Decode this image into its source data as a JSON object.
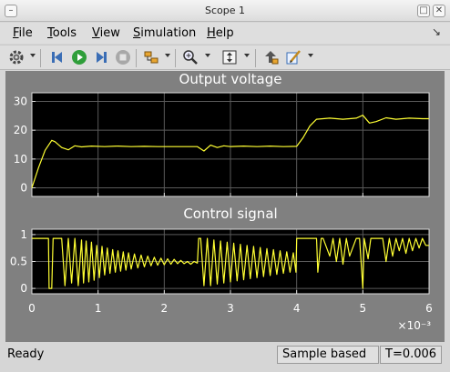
{
  "window": {
    "title": "Scope 1",
    "min_glyph": "–",
    "max_glyph": "□",
    "close_glyph": "✕"
  },
  "menu": {
    "file": {
      "mnemonic": "F",
      "rest": "ile"
    },
    "tools": {
      "mnemonic": "T",
      "rest": "ools"
    },
    "view": {
      "mnemonic": "V",
      "rest": "iew"
    },
    "simulation": {
      "mnemonic": "S",
      "rest": "imulation"
    },
    "help": {
      "mnemonic": "H",
      "rest": "elp"
    },
    "dock_glyph": "↘"
  },
  "toolbar": {
    "icons": [
      "gear-icon",
      "step-back-icon",
      "run-icon",
      "step-forward-icon",
      "stop-icon",
      "signal-selector-icon",
      "zoom-icon",
      "autoscale-icon",
      "highlight-block-icon",
      "style-icon"
    ]
  },
  "colors": {
    "plot_bg": "#000000",
    "trace": "#ffff33",
    "axes": "#dcdcdc",
    "grid": "#5a5a5a",
    "panel": "#808080"
  },
  "status": {
    "ready": "Ready",
    "mode": "Sample based",
    "time": "T=0.006"
  },
  "chart_data": [
    {
      "type": "line",
      "title": "Output voltage",
      "xlabel": "",
      "ylabel": "",
      "xlim": [
        0,
        6
      ],
      "ylim": [
        -3,
        33
      ],
      "x_ticks": [
        0,
        1,
        2,
        3,
        4,
        5,
        6
      ],
      "y_ticks": [
        0,
        10,
        20,
        30
      ],
      "grid": true,
      "series": [
        {
          "x": [
            0,
            0.1,
            0.2,
            0.3,
            0.35,
            0.45,
            0.55,
            0.65,
            0.75,
            0.9,
            1.1,
            1.3,
            1.5,
            1.7,
            1.9,
            2.1,
            2.3,
            2.5,
            2.6,
            2.7,
            2.8,
            2.9,
            3.0,
            3.2,
            3.4,
            3.6,
            3.8,
            4.0,
            4.1,
            4.2,
            4.3,
            4.5,
            4.7,
            4.9,
            5.0,
            5.1,
            5.2,
            5.35,
            5.5,
            5.7,
            5.9,
            6.0
          ],
          "y": [
            0,
            7,
            13,
            16.5,
            16,
            14,
            13.2,
            14.6,
            14.2,
            14.5,
            14.3,
            14.5,
            14.3,
            14.4,
            14.3,
            14.3,
            14.3,
            14.3,
            12.8,
            14.8,
            14.0,
            14.6,
            14.3,
            14.5,
            14.3,
            14.5,
            14.3,
            14.4,
            17.5,
            21.5,
            23.8,
            24.2,
            23.8,
            24.2,
            25.2,
            22.5,
            23.0,
            24.3,
            23.8,
            24.2,
            24.0,
            24.0
          ]
        }
      ]
    },
    {
      "type": "line",
      "title": "Control signal",
      "xlabel": "",
      "ylabel": "",
      "xlim": [
        0,
        6
      ],
      "ylim": [
        -0.1,
        1.1
      ],
      "x_ticks": [
        0,
        1,
        2,
        3,
        4,
        5,
        6
      ],
      "y_ticks": [
        0,
        0.5,
        1
      ],
      "x_scale_label": "×10⁻³",
      "grid": true,
      "series": [
        {
          "x": [
            0,
            0.25,
            0.26,
            0.3,
            0.32,
            0.45,
            0.5,
            0.55,
            0.6,
            0.65,
            0.7,
            0.75,
            0.78,
            0.82,
            0.86,
            0.9,
            0.94,
            0.98,
            1.02,
            1.06,
            1.1,
            1.14,
            1.18,
            1.22,
            1.26,
            1.3,
            1.34,
            1.38,
            1.42,
            1.46,
            1.5,
            1.55,
            1.6,
            1.65,
            1.7,
            1.75,
            1.8,
            1.85,
            1.9,
            1.95,
            2.0,
            2.05,
            2.1,
            2.15,
            2.2,
            2.25,
            2.3,
            2.35,
            2.4,
            2.45,
            2.5,
            2.52,
            2.55,
            2.6,
            2.65,
            2.7,
            2.75,
            2.8,
            2.85,
            2.9,
            2.95,
            3.0,
            3.05,
            3.1,
            3.15,
            3.2,
            3.25,
            3.3,
            3.35,
            3.4,
            3.45,
            3.5,
            3.55,
            3.6,
            3.65,
            3.7,
            3.75,
            3.8,
            3.85,
            3.9,
            3.95,
            3.99,
            4.0,
            4.3,
            4.32,
            4.37,
            4.4,
            4.5,
            4.55,
            4.6,
            4.65,
            4.7,
            4.75,
            4.8,
            4.9,
            4.95,
            5.0,
            5.02,
            5.08,
            5.12,
            5.3,
            5.35,
            5.4,
            5.45,
            5.5,
            5.55,
            5.6,
            5.65,
            5.7,
            5.75,
            5.8,
            5.85,
            5.9,
            5.95,
            6.0
          ],
          "y": [
            0.93,
            0.93,
            0,
            0,
            0.93,
            0.93,
            0.05,
            0.93,
            0.1,
            0.93,
            0.05,
            0.9,
            0.1,
            0.88,
            0.12,
            0.86,
            0.15,
            0.8,
            0.2,
            0.78,
            0.25,
            0.75,
            0.28,
            0.72,
            0.3,
            0.7,
            0.32,
            0.68,
            0.34,
            0.66,
            0.36,
            0.64,
            0.38,
            0.62,
            0.4,
            0.6,
            0.42,
            0.58,
            0.43,
            0.56,
            0.44,
            0.55,
            0.45,
            0.54,
            0.46,
            0.52,
            0.46,
            0.5,
            0.45,
            0.5,
            0.47,
            0.93,
            0.93,
            0.05,
            0.93,
            0.05,
            0.9,
            0.08,
            0.88,
            0.1,
            0.86,
            0.12,
            0.84,
            0.14,
            0.82,
            0.16,
            0.8,
            0.18,
            0.78,
            0.2,
            0.76,
            0.22,
            0.74,
            0.24,
            0.72,
            0.26,
            0.7,
            0.28,
            0.68,
            0.3,
            0.66,
            0.3,
            0.93,
            0.93,
            0.3,
            0.93,
            0.93,
            0.6,
            0.93,
            0.5,
            0.93,
            0.45,
            0.93,
            0.6,
            0.93,
            0.93,
            0,
            0.93,
            0.55,
            0.93,
            0.93,
            0.5,
            0.93,
            0.6,
            0.93,
            0.7,
            0.93,
            0.65,
            0.93,
            0.7,
            0.93,
            0.75,
            0.93,
            0.8,
            0.8
          ]
        }
      ]
    }
  ]
}
